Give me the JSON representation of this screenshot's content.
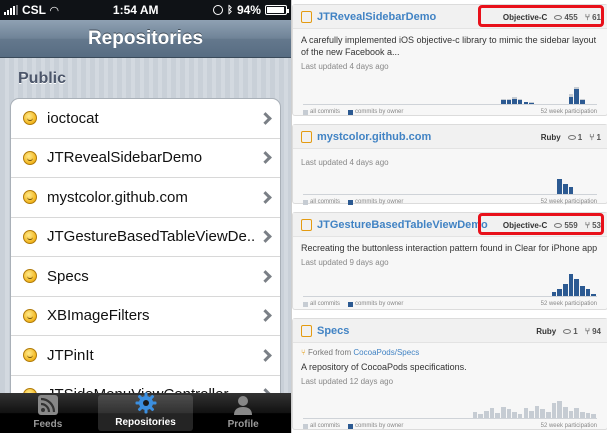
{
  "phone": {
    "status": {
      "carrier": "CSL",
      "time": "1:54 AM",
      "battery": "94%"
    },
    "nav_title": "Repositories",
    "section": "Public",
    "repos": [
      "ioctocat",
      "JTRevealSidebarDemo",
      "mystcolor.github.com",
      "JTGestureBasedTableViewDe...",
      "Specs",
      "XBImageFilters",
      "JTPinIt",
      "JTSideMenuViewController"
    ],
    "tabs": [
      {
        "label": "Feeds",
        "icon": "rss-icon"
      },
      {
        "label": "Repositories",
        "icon": "gear-icon"
      },
      {
        "label": "Profile",
        "icon": "person-icon"
      }
    ],
    "active_tab": "Repositories"
  },
  "web": {
    "colors": {
      "link": "#4183c4",
      "highlight": "#e8101a",
      "bar_owner": "#2c5a92",
      "bar_all": "#c6ccd3"
    },
    "repos": [
      {
        "name": "JTRevealSidebarDemo",
        "language": "Objective-C",
        "watchers": "455",
        "forks": "61",
        "highlighted": true,
        "description": "A carefully implemented iOS objective-c library to mimic the sidebar layout of the new Facebook a...",
        "updated": "Last updated 4 days ago",
        "participation_all": [
          0,
          0,
          0,
          0,
          0,
          0,
          0,
          0,
          0,
          0,
          0,
          0,
          0,
          0,
          0,
          0,
          0,
          0,
          0,
          0,
          0,
          0,
          0,
          0,
          0,
          0,
          0,
          0,
          0,
          0,
          0,
          0,
          0,
          0,
          0,
          4,
          4,
          6,
          4,
          2,
          2,
          0,
          0,
          0,
          0,
          0,
          0,
          8,
          14,
          4,
          0,
          0
        ],
        "participation_owner": [
          0,
          0,
          0,
          0,
          0,
          0,
          0,
          0,
          0,
          0,
          0,
          0,
          0,
          0,
          0,
          0,
          0,
          0,
          0,
          0,
          0,
          0,
          0,
          0,
          0,
          0,
          0,
          0,
          0,
          0,
          0,
          0,
          0,
          0,
          0,
          3,
          3,
          4,
          3,
          2,
          1,
          0,
          0,
          0,
          0,
          0,
          0,
          6,
          12,
          3,
          0,
          0
        ]
      },
      {
        "name": "mystcolor.github.com",
        "language": "Ruby",
        "watchers": "1",
        "forks": "1",
        "highlighted": false,
        "description": "",
        "updated": "Last updated 4 days ago",
        "participation_all": [
          0,
          0,
          0,
          0,
          0,
          0,
          0,
          0,
          0,
          0,
          0,
          0,
          0,
          0,
          0,
          0,
          0,
          0,
          0,
          0,
          0,
          0,
          0,
          0,
          0,
          0,
          0,
          0,
          0,
          0,
          0,
          0,
          0,
          0,
          0,
          0,
          0,
          0,
          0,
          0,
          0,
          0,
          0,
          0,
          0,
          12,
          8,
          6,
          0,
          0,
          0,
          0
        ],
        "participation_owner": [
          0,
          0,
          0,
          0,
          0,
          0,
          0,
          0,
          0,
          0,
          0,
          0,
          0,
          0,
          0,
          0,
          0,
          0,
          0,
          0,
          0,
          0,
          0,
          0,
          0,
          0,
          0,
          0,
          0,
          0,
          0,
          0,
          0,
          0,
          0,
          0,
          0,
          0,
          0,
          0,
          0,
          0,
          0,
          0,
          0,
          12,
          8,
          6,
          0,
          0,
          0,
          0
        ]
      },
      {
        "name": "JTGestureBasedTableViewDemo",
        "language": "Objective-C",
        "watchers": "559",
        "forks": "53",
        "highlighted": true,
        "description": "Recreating the buttonless interaction pattern found in Clear for iPhone app",
        "updated": "Last updated 9 days ago",
        "participation_all": [
          0,
          0,
          0,
          0,
          0,
          0,
          0,
          0,
          0,
          0,
          0,
          0,
          0,
          0,
          0,
          0,
          0,
          0,
          0,
          0,
          0,
          0,
          0,
          0,
          0,
          0,
          0,
          0,
          0,
          0,
          0,
          0,
          0,
          0,
          0,
          0,
          0,
          0,
          0,
          0,
          0,
          0,
          0,
          0,
          3,
          6,
          10,
          18,
          14,
          8,
          6,
          2
        ],
        "participation_owner": [
          0,
          0,
          0,
          0,
          0,
          0,
          0,
          0,
          0,
          0,
          0,
          0,
          0,
          0,
          0,
          0,
          0,
          0,
          0,
          0,
          0,
          0,
          0,
          0,
          0,
          0,
          0,
          0,
          0,
          0,
          0,
          0,
          0,
          0,
          0,
          0,
          0,
          0,
          0,
          0,
          0,
          0,
          0,
          0,
          3,
          6,
          10,
          18,
          14,
          8,
          6,
          2
        ]
      },
      {
        "name": "Specs",
        "language": "Ruby",
        "watchers": "1",
        "forks": "94",
        "highlighted": false,
        "forked_prefix": "Forked from",
        "forked_from": "CocoaPods/Specs",
        "description": "A repository of CocoaPods specifications.",
        "updated": "Last updated 12 days ago",
        "participation_all": [
          0,
          0,
          0,
          0,
          0,
          0,
          0,
          0,
          0,
          0,
          0,
          0,
          0,
          0,
          0,
          0,
          0,
          0,
          0,
          0,
          0,
          0,
          0,
          0,
          0,
          0,
          0,
          0,
          0,
          0,
          5,
          3,
          6,
          8,
          4,
          9,
          7,
          5,
          3,
          8,
          6,
          10,
          7,
          5,
          12,
          14,
          9,
          6,
          8,
          5,
          4,
          3
        ],
        "participation_owner": [
          0,
          0,
          0,
          0,
          0,
          0,
          0,
          0,
          0,
          0,
          0,
          0,
          0,
          0,
          0,
          0,
          0,
          0,
          0,
          0,
          0,
          0,
          0,
          0,
          0,
          0,
          0,
          0,
          0,
          0,
          0,
          0,
          0,
          0,
          0,
          0,
          0,
          0,
          0,
          0,
          0,
          0,
          0,
          0,
          0,
          0,
          0,
          0,
          0,
          0,
          0,
          0
        ]
      }
    ],
    "legend": {
      "all": "all commits",
      "owner": "commits by owner",
      "participation": "52 week participation"
    }
  }
}
